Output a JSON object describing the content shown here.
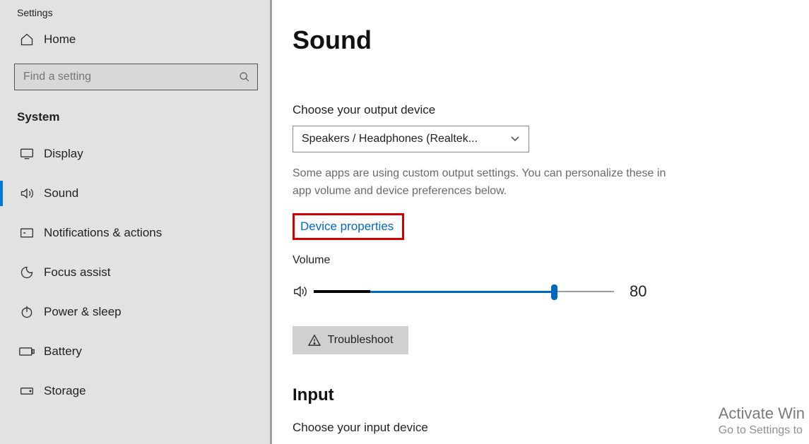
{
  "sidebar": {
    "app_title": "Settings",
    "home_label": "Home",
    "search_placeholder": "Find a setting",
    "category": "System",
    "items": [
      {
        "label": "Display"
      },
      {
        "label": "Sound"
      },
      {
        "label": "Notifications & actions"
      },
      {
        "label": "Focus assist"
      },
      {
        "label": "Power & sleep"
      },
      {
        "label": "Battery"
      },
      {
        "label": "Storage"
      }
    ],
    "selected_index": 1
  },
  "main": {
    "page_title": "Sound",
    "output_label": "Choose your output device",
    "output_device": "Speakers / Headphones (Realtek...",
    "hint": "Some apps are using custom output settings. You can personalize these in app volume and device preferences below.",
    "device_properties_link": "Device properties",
    "volume_label": "Volume",
    "volume_value": 80,
    "troubleshoot_label": "Troubleshoot",
    "input_heading": "Input",
    "input_label_partial": "Choose your input device"
  },
  "watermark": {
    "title": "Activate Win",
    "subtitle": "Go to Settings to"
  }
}
